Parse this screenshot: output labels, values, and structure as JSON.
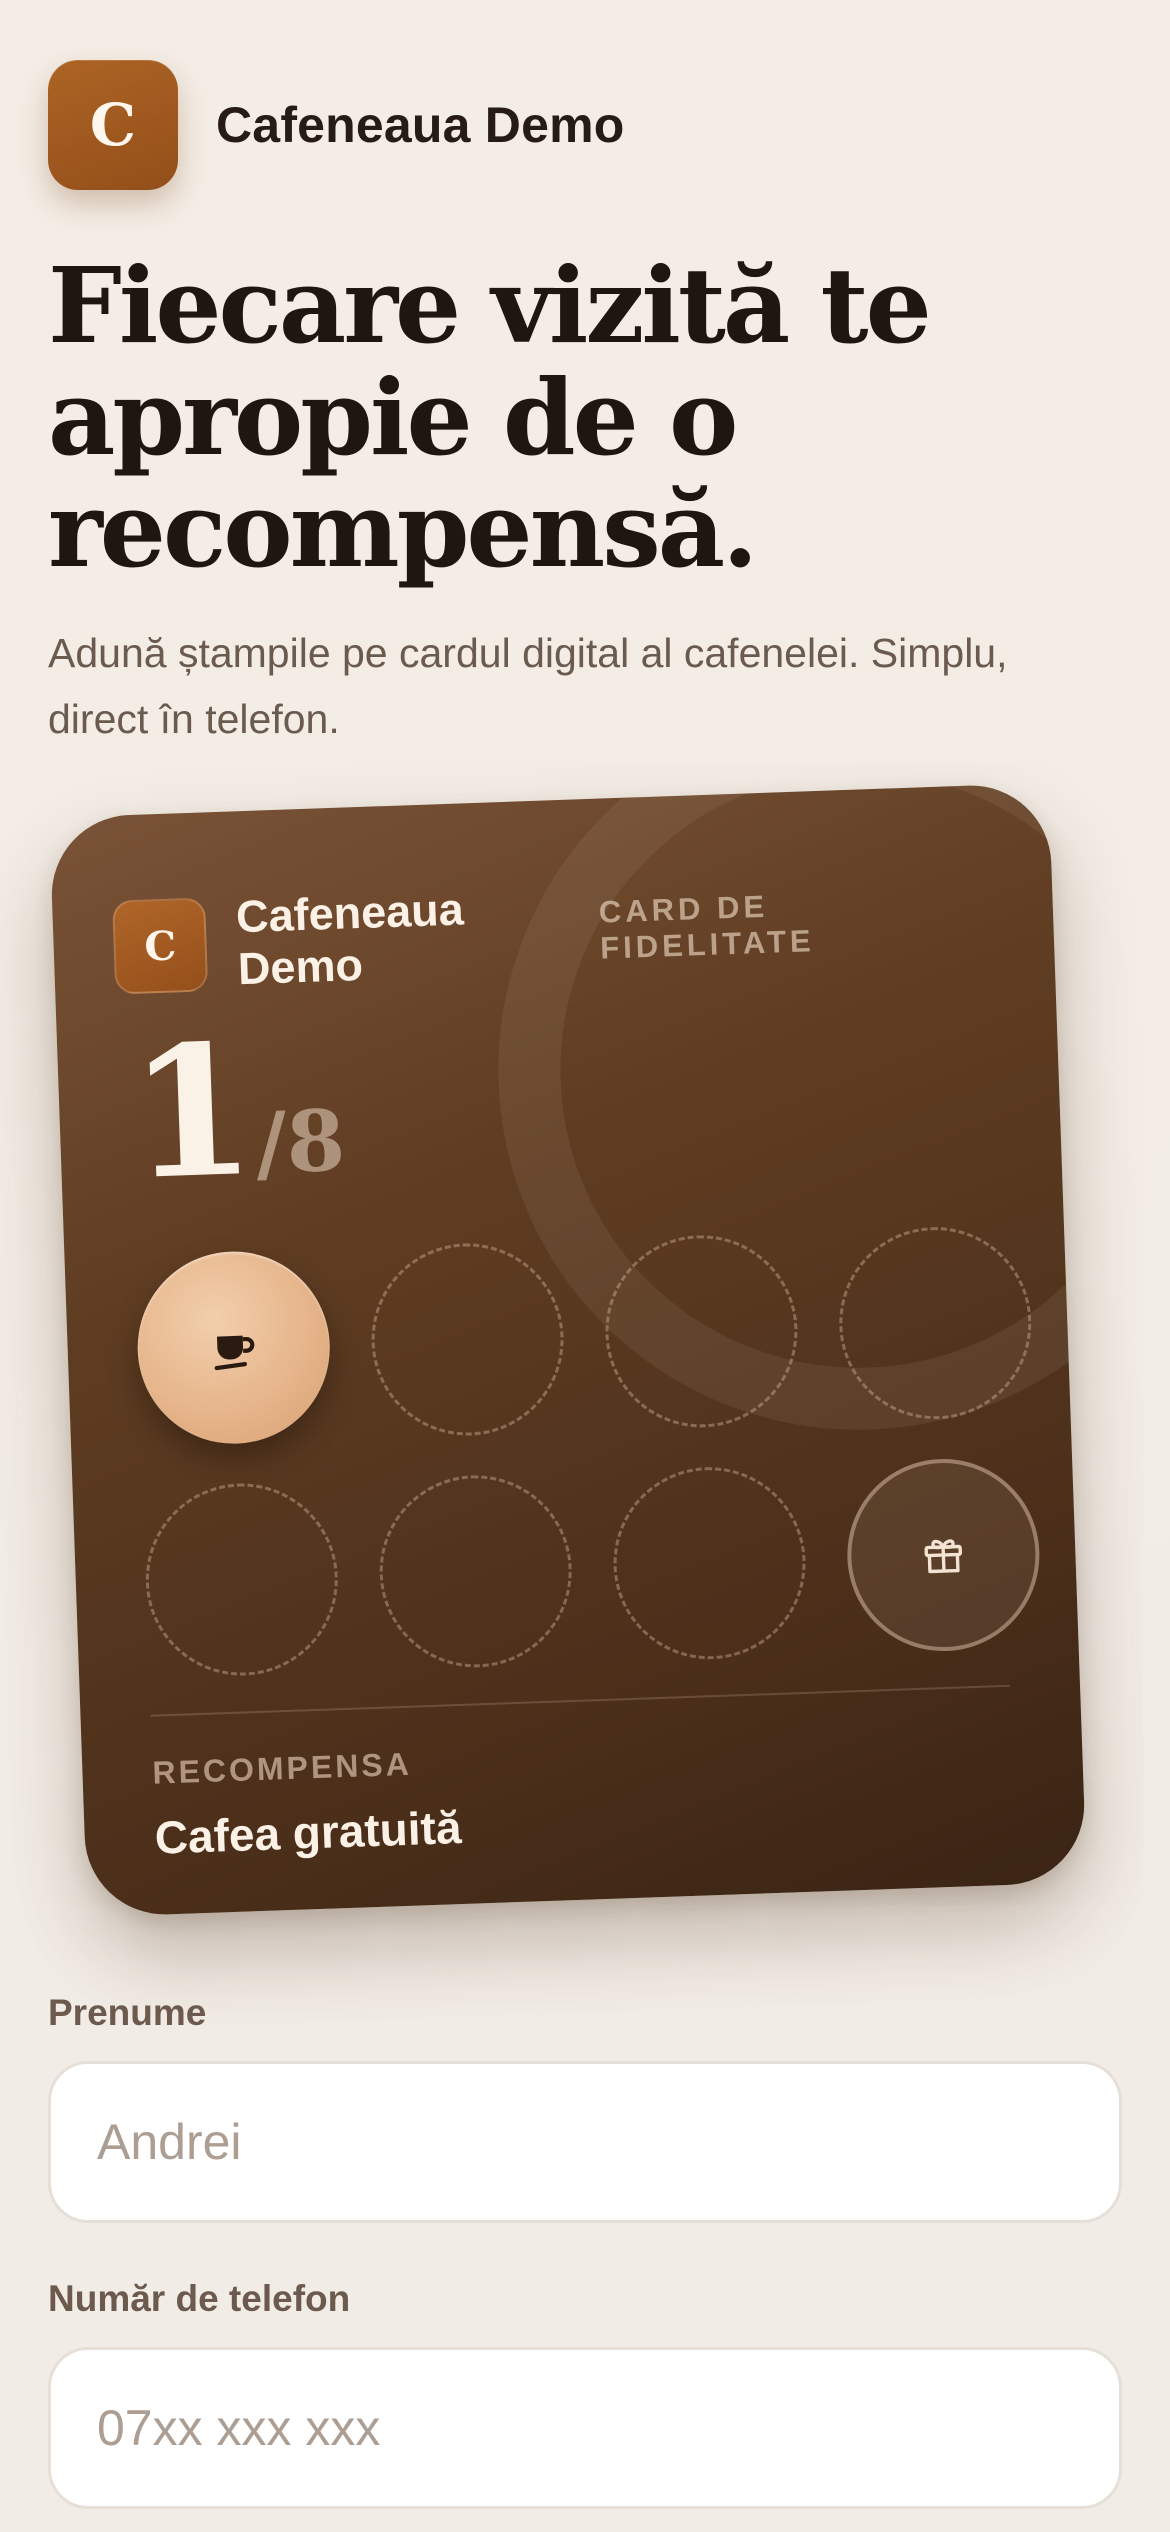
{
  "brand": {
    "logo_letter": "C",
    "name": "Cafeneaua Demo"
  },
  "hero": {
    "headline": "Fiecare vizită te apropie de o recompensă.",
    "subtitle": "Adună ștampile pe cardul digital al cafenelei. Simplu, direct în telefon."
  },
  "card": {
    "logo_letter": "C",
    "name": "Cafeneaua Demo",
    "tag": "CARD DE FIDELITATE",
    "stamps_collected": 1,
    "stamps_total": 8,
    "count_current": "1",
    "count_total": "/8",
    "stamps": [
      {
        "state": "filled",
        "icon": "coffee-cup-icon"
      },
      {
        "state": "empty"
      },
      {
        "state": "empty"
      },
      {
        "state": "empty"
      },
      {
        "state": "empty"
      },
      {
        "state": "empty"
      },
      {
        "state": "empty"
      },
      {
        "state": "reward",
        "icon": "gift-icon"
      }
    ],
    "reward_label": "RECOMPENSA",
    "reward_value": "Cafea gratuită"
  },
  "form": {
    "first_name_label": "Prenume",
    "first_name_placeholder": "Andrei",
    "first_name_value": "",
    "phone_label": "Număr de telefon",
    "phone_placeholder": "07xx xxx xxx",
    "phone_value": ""
  },
  "colors": {
    "accent": "#a15a20",
    "card_dark": "#4b2f1a",
    "stamp_filled": "#e6b58b",
    "background": "#f3ede6"
  }
}
